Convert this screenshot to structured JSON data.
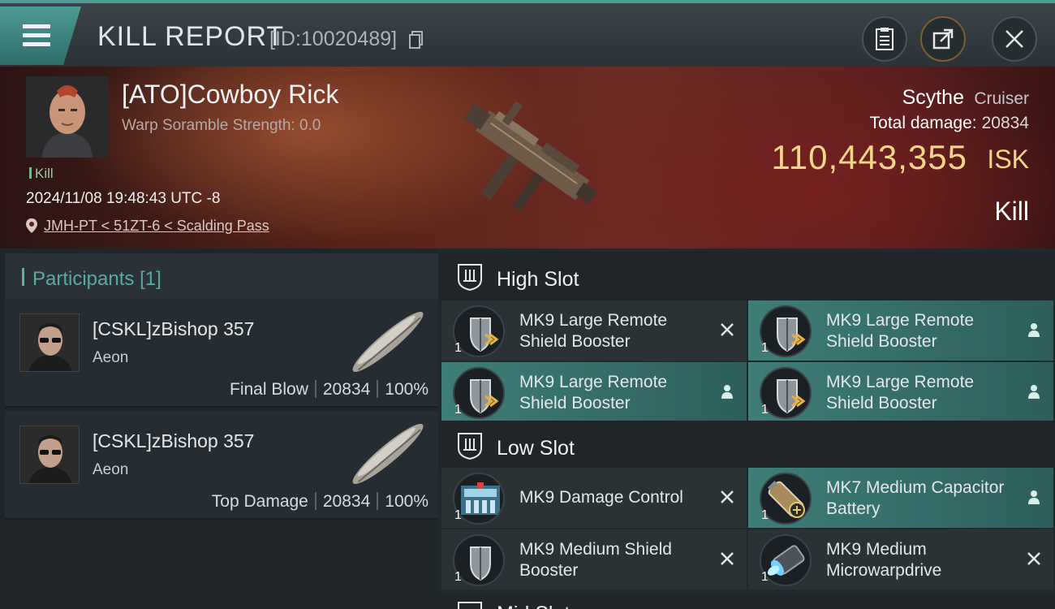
{
  "header": {
    "title": "KILL REPORT",
    "report_id": "[ID:10020489]"
  },
  "victim": {
    "name": "[ATO]Cowboy Rick",
    "warp_scramble": "Warp Soramble Strength: 0.0",
    "tag": "Kill",
    "timestamp": "2024/11/08 19:48:43 UTC -8",
    "location": "JMH-PT < 51ZT-6 < Scalding Pass",
    "ship_name": "Scythe",
    "ship_class": "Cruiser",
    "total_damage_label": "Total damage:",
    "total_damage": "20834",
    "isk_value": "110,443,355",
    "isk_unit": "ISK",
    "result": "Kill"
  },
  "participants": {
    "title": "Participants",
    "count": "[1]",
    "list": [
      {
        "name": "[CSKL]zBishop 357",
        "ship": "Aeon",
        "role": "Final Blow",
        "damage": "20834",
        "percent": "100%"
      },
      {
        "name": "[CSKL]zBishop 357",
        "ship": "Aeon",
        "role": "Top Damage",
        "damage": "20834",
        "percent": "100%"
      }
    ]
  },
  "slots": {
    "high": {
      "title": "High Slot",
      "modules": [
        {
          "name": "MK9 Large Remote Shield Booster",
          "qty": "1",
          "status": "destroyed",
          "icon": "shield-booster-icon"
        },
        {
          "name": "MK9 Large Remote Shield Booster",
          "qty": "1",
          "status": "dropped",
          "icon": "shield-booster-icon"
        },
        {
          "name": "MK9 Large Remote Shield Booster",
          "qty": "1",
          "status": "dropped",
          "icon": "shield-booster-icon"
        },
        {
          "name": "MK9 Large Remote Shield Booster",
          "qty": "1",
          "status": "dropped",
          "icon": "shield-booster-icon"
        }
      ]
    },
    "low": {
      "title": "Low Slot",
      "modules": [
        {
          "name": "MK9 Damage Control",
          "qty": "1",
          "status": "destroyed",
          "icon": "damage-control-icon"
        },
        {
          "name": "MK7 Medium Capacitor Battery",
          "qty": "1",
          "status": "dropped",
          "icon": "capacitor-battery-icon"
        },
        {
          "name": "MK9 Medium Shield Booster",
          "qty": "1",
          "status": "destroyed",
          "icon": "shield-booster-icon"
        },
        {
          "name": "MK9 Medium Microwarpdrive",
          "qty": "1",
          "status": "destroyed",
          "icon": "microwarpdrive-icon"
        }
      ]
    },
    "mid": {
      "title": "Mid Slot"
    }
  },
  "colors": {
    "accent": "#4f9a93",
    "isk": "#f3d789",
    "highlight_row": "#3f7d78"
  }
}
